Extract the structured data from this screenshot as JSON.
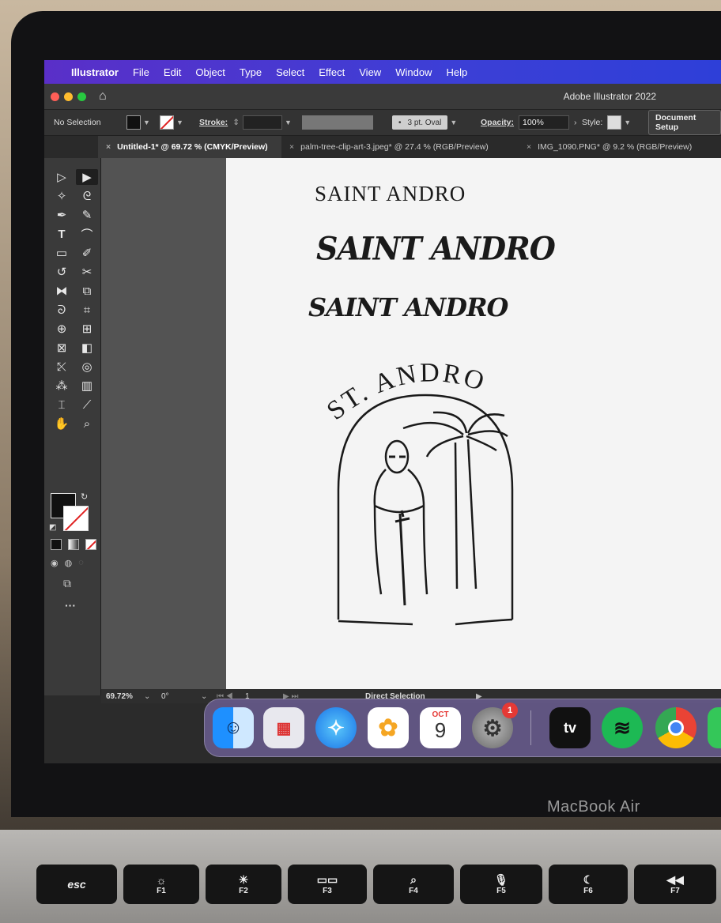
{
  "menubar": {
    "apple_icon": "apple-icon",
    "app": "Illustrator",
    "items": [
      "File",
      "Edit",
      "Object",
      "Type",
      "Select",
      "Effect",
      "View",
      "Window",
      "Help"
    ]
  },
  "window": {
    "title": "Adobe Illustrator 2022",
    "traffic_colors": [
      "#ff5f57",
      "#febc2e",
      "#28c840"
    ]
  },
  "control_bar": {
    "selection": "No Selection",
    "stroke_label": "Stroke:",
    "brush": "3 pt. Oval",
    "opacity_label": "Opacity:",
    "opacity_value": "100%",
    "style_label": "Style:",
    "doc_setup": "Document Setup"
  },
  "tabs": [
    {
      "label": "Untitled-1* @ 69.72 % (CMYK/Preview)",
      "active": true
    },
    {
      "label": "palm-tree-clip-art-3.jpeg* @ 27.4 % (RGB/Preview)",
      "active": false
    },
    {
      "label": "IMG_1090.PNG* @ 9.2 % (RGB/Preview)",
      "active": false
    }
  ],
  "artboard": {
    "line1": "SAINT ANDRO",
    "line2": "SAINT ANDRO",
    "line3": "SAINT ANDRO",
    "arc_text": "ST. ANDRO"
  },
  "status": {
    "zoom": "69.72%",
    "rotation": "0°",
    "page": "1",
    "tool": "Direct Selection"
  },
  "dock": {
    "calendar_month": "OCT",
    "calendar_day": "9",
    "settings_badge": "1",
    "tv_label": "tv"
  },
  "laptop": {
    "brand": "MacBook Air"
  },
  "keys": [
    {
      "label": "esc",
      "sub": ""
    },
    {
      "label": "☼",
      "sub": "F1"
    },
    {
      "label": "☀",
      "sub": "F2"
    },
    {
      "label": "▭▭",
      "sub": "F3"
    },
    {
      "label": "⌕",
      "sub": "F4"
    },
    {
      "label": "🎙",
      "sub": "F5"
    },
    {
      "label": "☾",
      "sub": "F6"
    },
    {
      "label": "◀◀",
      "sub": "F7"
    }
  ]
}
